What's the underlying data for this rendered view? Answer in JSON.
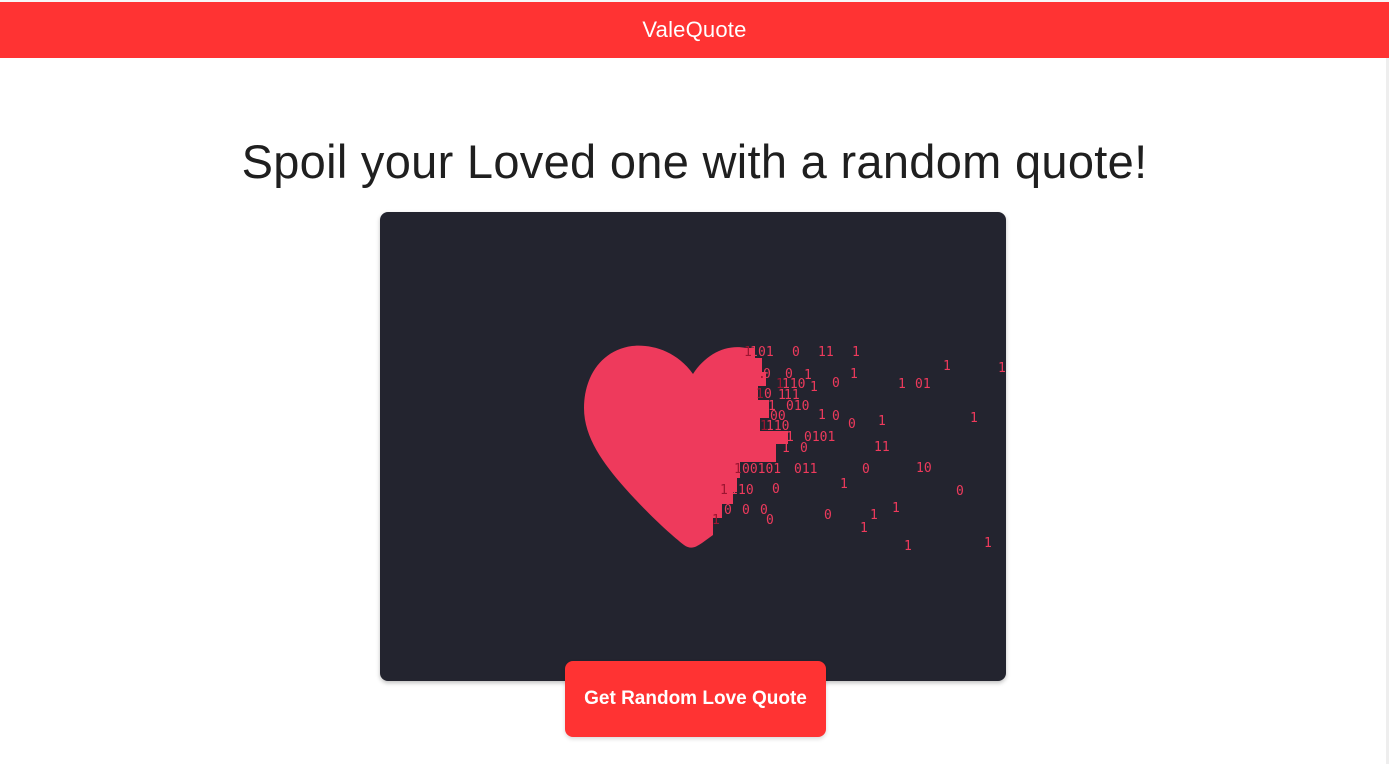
{
  "app": {
    "brand": "ValeQuote"
  },
  "hero": {
    "headline": "Spoil your Loved one with a random quote!"
  },
  "illustration": {
    "icon": "heart-binary-dissolve-icon",
    "heart_color": "#ee3a5c",
    "background_color": "#23242f"
  },
  "actions": {
    "get_quote_label": "Get Random Love Quote"
  },
  "colors": {
    "accent": "#ff3333",
    "text": "#1f1f1f"
  }
}
